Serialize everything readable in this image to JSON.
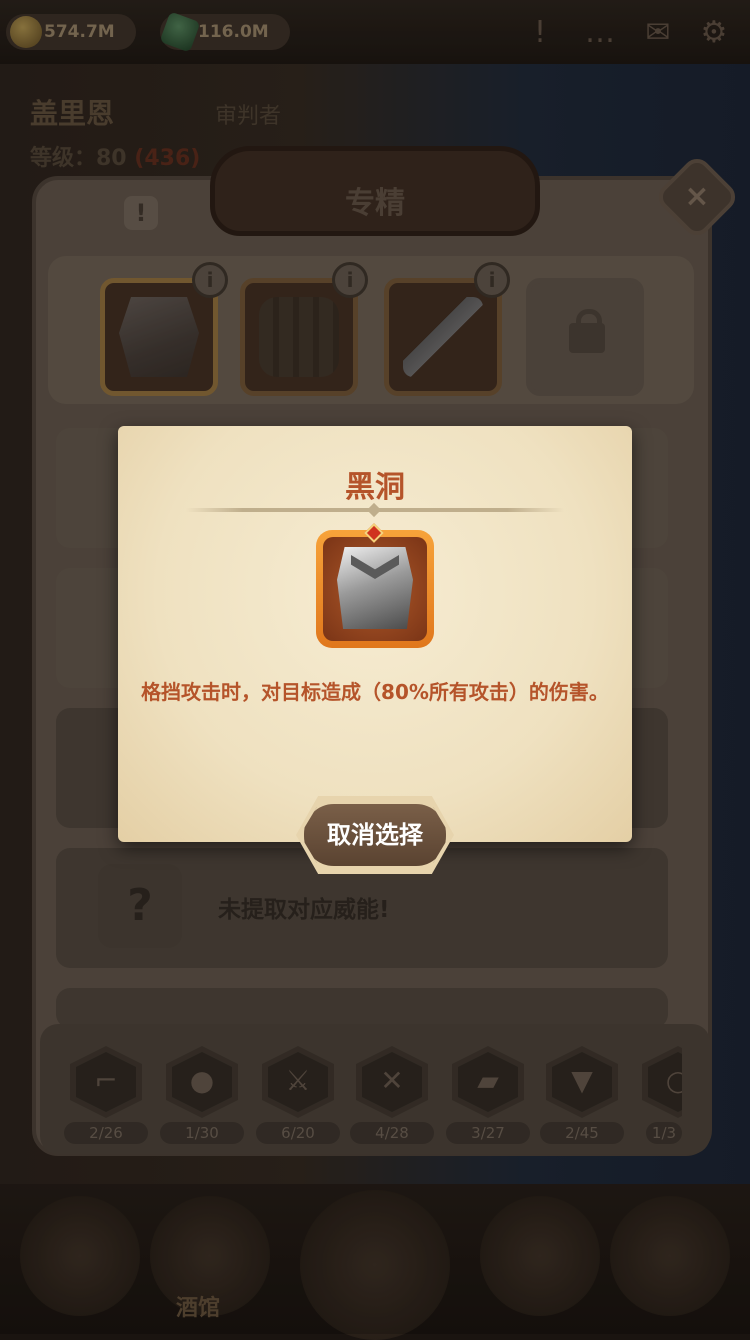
{
  "topbar": {
    "gold": "574.7M",
    "gems": "116.0M"
  },
  "hero": {
    "name": "盖里恩",
    "class": "审判者",
    "level_label": "等级：80",
    "level_extra": "(436)"
  },
  "panel": {
    "title": "专精",
    "info_symbol": "!",
    "close_symbol": "×",
    "slot_info_symbol": "i"
  },
  "rows": {
    "empty_symbol": "?",
    "empty_message": "未提取对应威能!"
  },
  "tabs": [
    {
      "icon": "boot-icon",
      "count": "2/26"
    },
    {
      "icon": "drumstick-icon",
      "count": "1/30"
    },
    {
      "icon": "sword-icon",
      "count": "6/20"
    },
    {
      "icon": "shield-icon",
      "count": "4/28"
    },
    {
      "icon": "book-icon",
      "count": "3/27"
    },
    {
      "icon": "armor-icon",
      "count": "2/45"
    },
    {
      "icon": "staff-icon",
      "count": "1/3"
    }
  ],
  "bottom_nav": {
    "tavern": "酒馆"
  },
  "popup": {
    "title": "黑洞",
    "description": "格挡攻击时，对目标造成（80%所有攻击）的伤害。",
    "cancel_label": "取消选择",
    "accent": "#b5542a"
  }
}
